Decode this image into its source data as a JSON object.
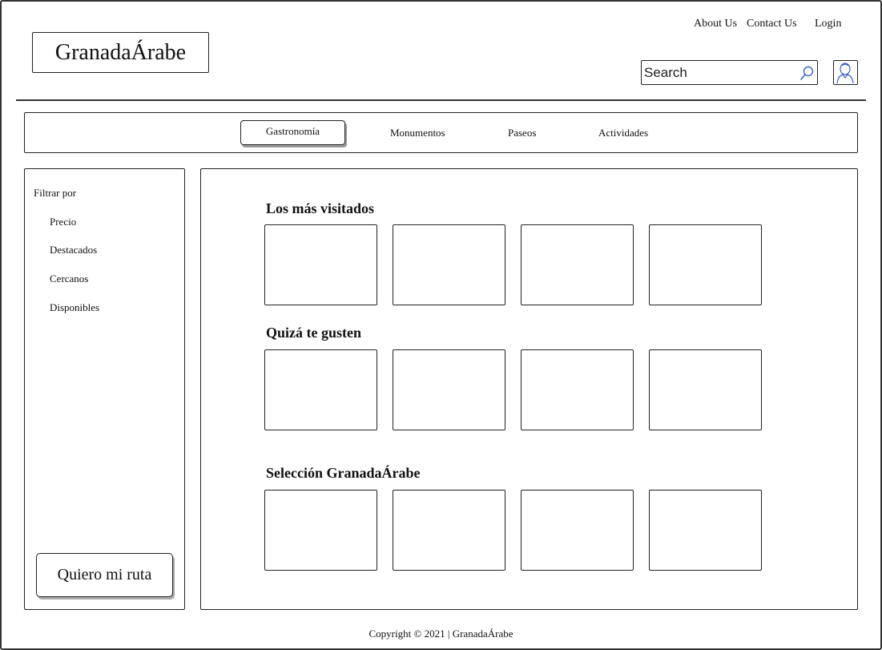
{
  "header": {
    "logo": "GranadaÁrabe",
    "links": [
      "About Us",
      "Contact Us",
      "Login"
    ],
    "search_placeholder": "Search"
  },
  "nav": {
    "tabs": [
      "Gastronomía",
      "Monumentos",
      "Paseos",
      "Actividades"
    ],
    "selected": "Gastronomía"
  },
  "sidebar": {
    "title": "Filtrar por",
    "filters": [
      "Precio",
      "Destacados",
      "Cercanos",
      "Disponibles"
    ],
    "route_button": "Quiero mi ruta"
  },
  "main": {
    "sections": [
      {
        "title": "Los más visitados",
        "card_count": 4
      },
      {
        "title": "Quizá te gusten",
        "card_count": 4
      },
      {
        "title": "Selección GranadaÁrabe",
        "card_count": 4
      }
    ]
  },
  "footer": {
    "text": "Copyright © 2021 | GranadaÁrabe"
  },
  "icons": {
    "search": "search-icon",
    "avatar": "user-avatar-icon"
  }
}
